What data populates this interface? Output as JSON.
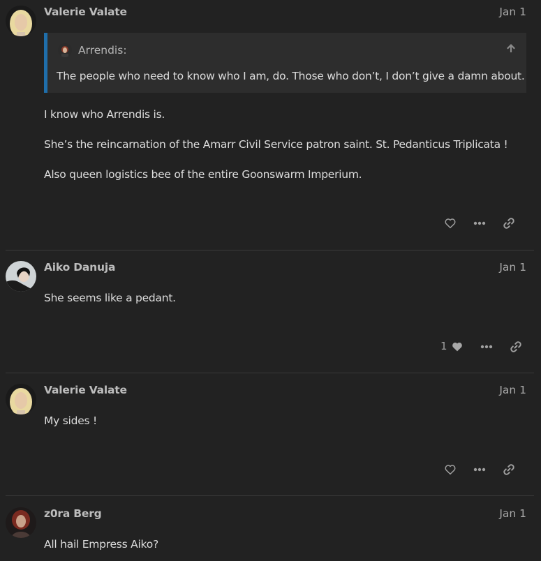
{
  "posts": [
    {
      "username": "Valerie Valate",
      "date": "Jan 1",
      "quote": {
        "author": "Arrendis:",
        "text": "The people who need to know who I am, do. Those who don’t, I don’t give a damn about."
      },
      "paragraphs": [
        "I know who Arrendis is.",
        "She’s the reincarnation of the Amarr Civil Service patron saint. St. Pedanticus Triplicata !",
        "Also queen logistics bee of the entire Goonswarm Imperium."
      ],
      "likes": ""
    },
    {
      "username": "Aiko Danuja",
      "date": "Jan 1",
      "paragraphs": [
        "She seems like a pedant."
      ],
      "likes": "1"
    },
    {
      "username": "Valerie Valate",
      "date": "Jan 1",
      "paragraphs": [
        "My sides !"
      ],
      "likes": ""
    },
    {
      "username": "z0ra Berg",
      "date": "Jan 1",
      "paragraphs": [
        "All hail Empress Aiko?"
      ]
    }
  ],
  "icons": {
    "like": "heart-icon",
    "more": "ellipsis-icon",
    "share": "link-icon",
    "quote_up": "arrow-up-icon"
  },
  "colors": {
    "background": "#222222",
    "quote_border": "#1f6eaa",
    "quote_bg": "#2d2d2d"
  }
}
